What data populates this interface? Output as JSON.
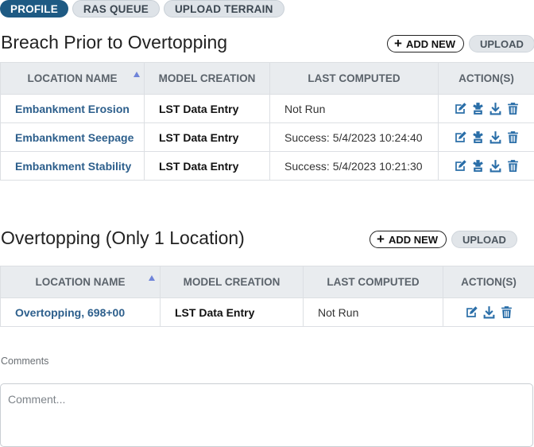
{
  "tabs": [
    {
      "label": "PROFILE",
      "active": true
    },
    {
      "label": "RAS QUEUE",
      "active": false
    },
    {
      "label": "UPLOAD TERRAIN",
      "active": false
    }
  ],
  "breach": {
    "title": "Breach Prior to Overtopping",
    "add_new_label": "ADD NEW",
    "upload_label": "UPLOAD",
    "columns": [
      "LOCATION NAME",
      "MODEL CREATION",
      "LAST COMPUTED",
      "ACTION(S)"
    ],
    "rows": [
      {
        "location": "Embankment Erosion",
        "model": "LST Data Entry",
        "last": "Not Run"
      },
      {
        "location": "Embankment Seepage",
        "model": "LST Data Entry",
        "last": "Success: 5/4/2023 10:24:40"
      },
      {
        "location": "Embankment Stability",
        "model": "LST Data Entry",
        "last": "Success: 5/4/2023 10:21:30"
      }
    ]
  },
  "overtopping": {
    "title": "Overtopping (Only 1 Location)",
    "add_new_label": "ADD NEW",
    "upload_label": "UPLOAD",
    "columns": [
      "LOCATION NAME",
      "MODEL CREATION",
      "LAST COMPUTED",
      "ACTION(S)"
    ],
    "rows": [
      {
        "location": "Overtopping, 698+00",
        "model": "LST Data Entry",
        "last": "Not Run"
      }
    ]
  },
  "comments": {
    "label": "Comments",
    "placeholder": "Comment..."
  },
  "colors": {
    "accent": "#1e5a83",
    "link": "#2d5f8c",
    "icon": "#2a6ea8",
    "sort": "#6f84d9"
  }
}
